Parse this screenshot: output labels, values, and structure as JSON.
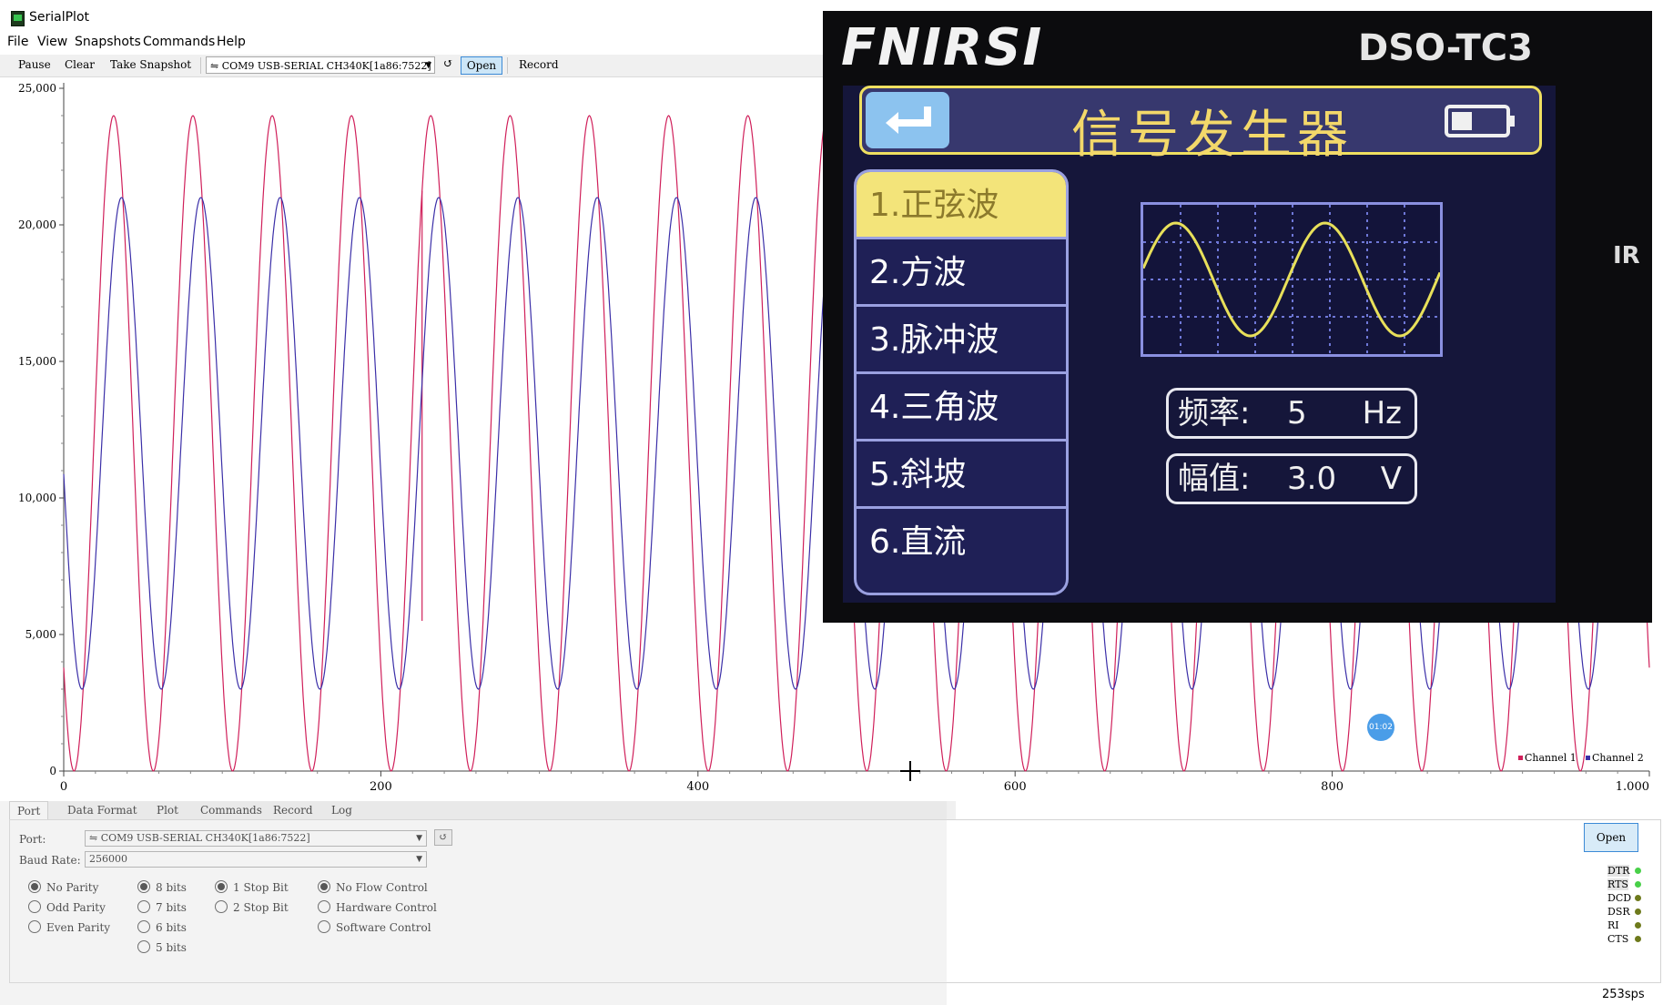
{
  "window": {
    "title": "SerialPlot"
  },
  "menu": [
    "File",
    "View",
    "Snapshots",
    "Commands",
    "Help"
  ],
  "toolbar": {
    "pause": "Pause",
    "clear": "Clear",
    "snapshot": "Take Snapshot",
    "port": "COM9 USB-SERIAL CH340K[1a86:7522]",
    "open": "Open",
    "record": "Record"
  },
  "chart_data": {
    "type": "line",
    "x_range": [
      0,
      1000
    ],
    "ylim": [
      0,
      25000
    ],
    "x_ticks": [
      "0",
      "200",
      "400",
      "600",
      "800",
      "1.000"
    ],
    "y_ticks": [
      "0",
      "5,000",
      "10,000",
      "15,000",
      "20,000",
      "25,000"
    ],
    "grid": false,
    "legend_position": "bottom-right",
    "series": [
      {
        "name": "Channel 1",
        "color": "#d01f5a",
        "period": 50,
        "min": 0,
        "max": 24000,
        "glitch_x": 226,
        "glitch_value": 5500
      },
      {
        "name": "Channel 2",
        "color": "#3b2fa8",
        "period": 50,
        "min": 3000,
        "max": 21000
      }
    ]
  },
  "overlay_photo": {
    "brand": "FNIRSI",
    "model": "DSO-TC3",
    "ir": "IR",
    "screen_title": "信号发生器",
    "waves": [
      "1.正弦波",
      "2.方波",
      "3.脉冲波",
      "4.三角波",
      "5.斜坡",
      "6.直流"
    ],
    "selected_index": 0,
    "freq_label": "频率:",
    "freq_value": "5",
    "freq_unit": "Hz",
    "amp_label": "幅值:",
    "amp_value": "3.0",
    "amp_unit": "V"
  },
  "tabs": [
    "Port",
    "Data Format",
    "Plot",
    "Commands",
    "Record",
    "Log"
  ],
  "port_panel": {
    "port_label": "Port:",
    "port_value": "COM9 USB-SERIAL CH340K[1a86:7522]",
    "baud_label": "Baud Rate:",
    "baud_value": "256000",
    "parity": [
      "No Parity",
      "Odd Parity",
      "Even Parity"
    ],
    "bits": [
      "8 bits",
      "7 bits",
      "6 bits",
      "5 bits"
    ],
    "stop": [
      "1 Stop Bit",
      "2 Stop Bit"
    ],
    "flow": [
      "No Flow Control",
      "Hardware Control",
      "Software Control"
    ],
    "open": "Open",
    "pins": [
      {
        "name": "DTR",
        "color": "#48d048"
      },
      {
        "name": "RTS",
        "color": "#48d048"
      },
      {
        "name": "DCD",
        "color": "#6e7a1c"
      },
      {
        "name": "DSR",
        "color": "#6e7a1c"
      },
      {
        "name": "RI",
        "color": "#6e7a1c"
      },
      {
        "name": "CTS",
        "color": "#6e7a1c"
      }
    ]
  },
  "status": {
    "sps": "253sps",
    "timer": "01:02"
  }
}
